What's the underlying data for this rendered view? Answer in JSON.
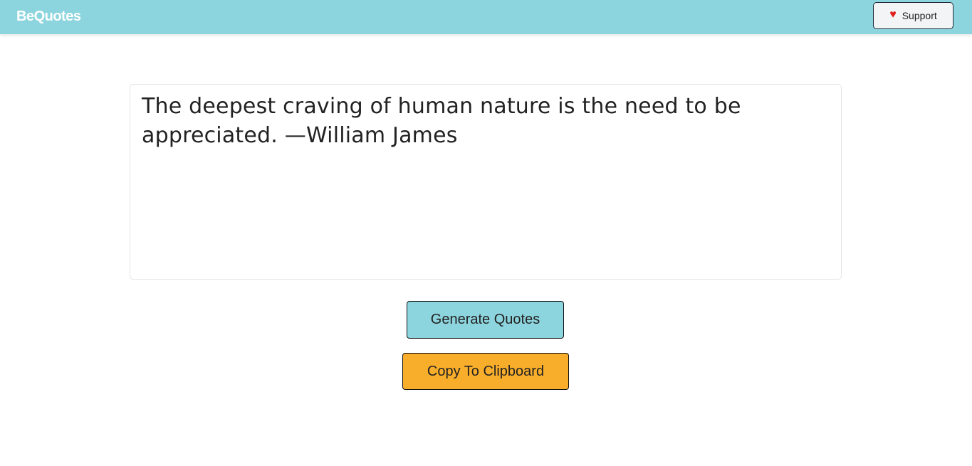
{
  "navbar": {
    "brand": "BeQuotes",
    "support_label": "Support",
    "support_icon": "heart-icon",
    "background_color": "#8dd5de"
  },
  "quote": {
    "text": "The deepest craving of human nature is the need to be appreciated. —William James"
  },
  "actions": {
    "generate_label": "Generate Quotes",
    "copy_label": "Copy To Clipboard",
    "generate_color": "#8dd5de",
    "copy_color": "#f9ae2b"
  }
}
